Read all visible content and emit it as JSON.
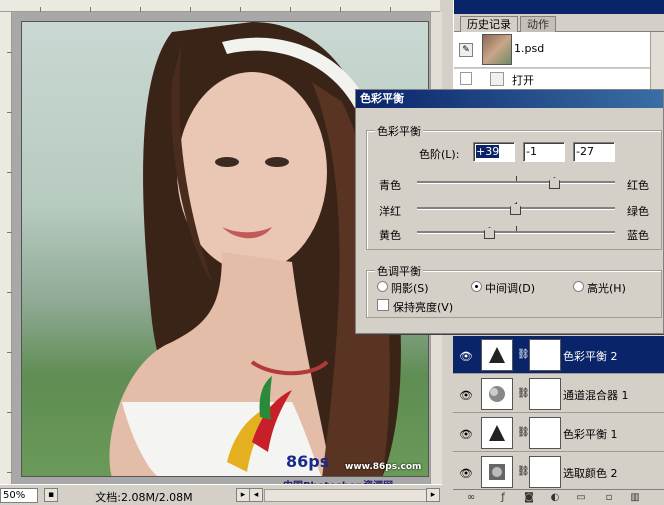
{
  "document": {
    "zoom": "50%",
    "doc_size": "文档:2.08M/2.08M"
  },
  "history_panel": {
    "tabs": [
      {
        "label": "历史记录",
        "active": true
      },
      {
        "label": "动作",
        "active": false
      }
    ],
    "snapshot_name": "1.psd",
    "steps": [
      {
        "label": "打开"
      }
    ]
  },
  "color_balance_dialog": {
    "title": "色彩平衡",
    "group_balance": "色彩平衡",
    "levels_label": "色阶(L):",
    "levels": [
      "+39",
      "-1",
      "-27"
    ],
    "sliders": [
      {
        "left": "青色",
        "right": "红色",
        "value": 39
      },
      {
        "left": "洋红",
        "right": "绿色",
        "value": -1
      },
      {
        "left": "黄色",
        "right": "蓝色",
        "value": -27
      }
    ],
    "group_tone": "色调平衡",
    "tone_options": [
      {
        "label": "阴影(S)",
        "selected": false
      },
      {
        "label": "中间调(D)",
        "selected": true
      },
      {
        "label": "高光(H)",
        "selected": false
      }
    ],
    "preserve_luminosity": {
      "label": "保持亮度(V)",
      "checked": false
    }
  },
  "layers_panel": {
    "layers": [
      {
        "name": "色彩平衡 2",
        "selected": true
      },
      {
        "name": "通道混合器 1",
        "selected": false
      },
      {
        "name": "色彩平衡 1",
        "selected": false
      },
      {
        "name": "选取颜色 2",
        "selected": false
      }
    ]
  },
  "watermark": {
    "logo_text": "86ps",
    "site": "www.86ps.com",
    "name": "中国Photoshop资源网"
  },
  "colors": {
    "selection_blue": "#0a246a",
    "dialog_bg": "#d4d0c8"
  }
}
